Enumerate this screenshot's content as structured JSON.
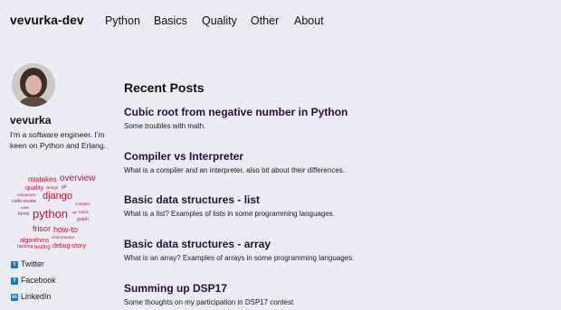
{
  "site": {
    "brand": "vevurka-dev"
  },
  "nav": {
    "items": [
      "Python",
      "Basics",
      "Quality",
      "Other",
      "About"
    ]
  },
  "sidebar": {
    "author": "vevurka",
    "bio": "I'm a software engineer. I'm keen on Python and Erlang.",
    "tags": [
      "mistakes",
      "overview",
      "quality",
      "design",
      "git",
      "resources",
      "django",
      "code-review",
      "complex",
      "koffie",
      "forms",
      "python",
      "cpl",
      "travis",
      "graph",
      "frisor",
      "how-to",
      "environment",
      "algorithms",
      "hacking",
      "testing",
      "debug-story"
    ],
    "social": [
      {
        "label": "Twitter",
        "icon": "twitter-icon"
      },
      {
        "label": "Facebook",
        "icon": "facebook-icon"
      },
      {
        "label": "LinkedIn",
        "icon": "linkedin-icon"
      }
    ]
  },
  "main": {
    "section_title": "Recent Posts",
    "posts": [
      {
        "title": "Cubic root from negative number in Python",
        "description": "Some troubles with math."
      },
      {
        "title": "Compiler vs Interpreter",
        "description": "What is a compiler and an interpreter, also bit about their differences."
      },
      {
        "title": "Basic data structures - list",
        "description": "What is a list? Examples of lists in some programming languages."
      },
      {
        "title": "Basic data structures - array",
        "description": "What is an array? Examples of arrays in some programming languages."
      },
      {
        "title": "Summing up DSP17",
        "description": "Some thoughts on my participation in DSP17 contest"
      }
    ]
  },
  "colors": {
    "background": "#ececf4",
    "tag": "#c8102e",
    "post_title": "#2a0e3c",
    "social": "#1d7ab8"
  }
}
